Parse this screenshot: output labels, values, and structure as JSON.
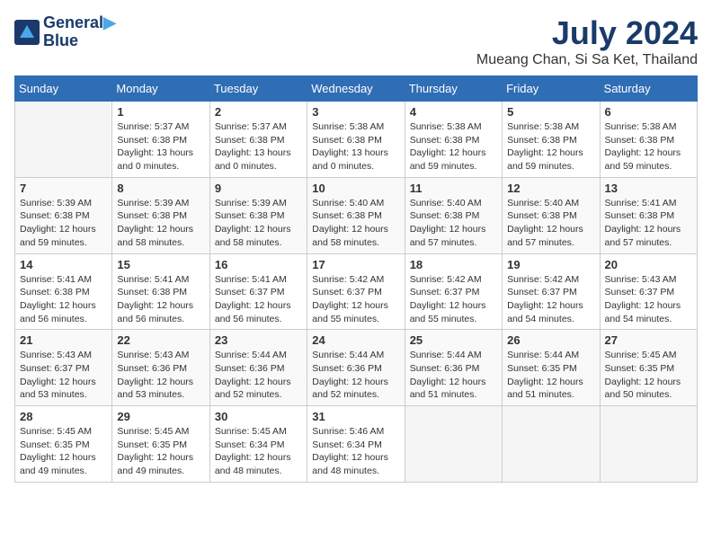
{
  "header": {
    "logo_line1": "General",
    "logo_line2": "Blue",
    "month": "July 2024",
    "location": "Mueang Chan, Si Sa Ket, Thailand"
  },
  "days_of_week": [
    "Sunday",
    "Monday",
    "Tuesday",
    "Wednesday",
    "Thursday",
    "Friday",
    "Saturday"
  ],
  "weeks": [
    [
      {
        "day": "",
        "info": ""
      },
      {
        "day": "1",
        "info": "Sunrise: 5:37 AM\nSunset: 6:38 PM\nDaylight: 13 hours\nand 0 minutes."
      },
      {
        "day": "2",
        "info": "Sunrise: 5:37 AM\nSunset: 6:38 PM\nDaylight: 13 hours\nand 0 minutes."
      },
      {
        "day": "3",
        "info": "Sunrise: 5:38 AM\nSunset: 6:38 PM\nDaylight: 13 hours\nand 0 minutes."
      },
      {
        "day": "4",
        "info": "Sunrise: 5:38 AM\nSunset: 6:38 PM\nDaylight: 12 hours\nand 59 minutes."
      },
      {
        "day": "5",
        "info": "Sunrise: 5:38 AM\nSunset: 6:38 PM\nDaylight: 12 hours\nand 59 minutes."
      },
      {
        "day": "6",
        "info": "Sunrise: 5:38 AM\nSunset: 6:38 PM\nDaylight: 12 hours\nand 59 minutes."
      }
    ],
    [
      {
        "day": "7",
        "info": "Sunrise: 5:39 AM\nSunset: 6:38 PM\nDaylight: 12 hours\nand 59 minutes."
      },
      {
        "day": "8",
        "info": "Sunrise: 5:39 AM\nSunset: 6:38 PM\nDaylight: 12 hours\nand 58 minutes."
      },
      {
        "day": "9",
        "info": "Sunrise: 5:39 AM\nSunset: 6:38 PM\nDaylight: 12 hours\nand 58 minutes."
      },
      {
        "day": "10",
        "info": "Sunrise: 5:40 AM\nSunset: 6:38 PM\nDaylight: 12 hours\nand 58 minutes."
      },
      {
        "day": "11",
        "info": "Sunrise: 5:40 AM\nSunset: 6:38 PM\nDaylight: 12 hours\nand 57 minutes."
      },
      {
        "day": "12",
        "info": "Sunrise: 5:40 AM\nSunset: 6:38 PM\nDaylight: 12 hours\nand 57 minutes."
      },
      {
        "day": "13",
        "info": "Sunrise: 5:41 AM\nSunset: 6:38 PM\nDaylight: 12 hours\nand 57 minutes."
      }
    ],
    [
      {
        "day": "14",
        "info": "Sunrise: 5:41 AM\nSunset: 6:38 PM\nDaylight: 12 hours\nand 56 minutes."
      },
      {
        "day": "15",
        "info": "Sunrise: 5:41 AM\nSunset: 6:38 PM\nDaylight: 12 hours\nand 56 minutes."
      },
      {
        "day": "16",
        "info": "Sunrise: 5:41 AM\nSunset: 6:37 PM\nDaylight: 12 hours\nand 56 minutes."
      },
      {
        "day": "17",
        "info": "Sunrise: 5:42 AM\nSunset: 6:37 PM\nDaylight: 12 hours\nand 55 minutes."
      },
      {
        "day": "18",
        "info": "Sunrise: 5:42 AM\nSunset: 6:37 PM\nDaylight: 12 hours\nand 55 minutes."
      },
      {
        "day": "19",
        "info": "Sunrise: 5:42 AM\nSunset: 6:37 PM\nDaylight: 12 hours\nand 54 minutes."
      },
      {
        "day": "20",
        "info": "Sunrise: 5:43 AM\nSunset: 6:37 PM\nDaylight: 12 hours\nand 54 minutes."
      }
    ],
    [
      {
        "day": "21",
        "info": "Sunrise: 5:43 AM\nSunset: 6:37 PM\nDaylight: 12 hours\nand 53 minutes."
      },
      {
        "day": "22",
        "info": "Sunrise: 5:43 AM\nSunset: 6:36 PM\nDaylight: 12 hours\nand 53 minutes."
      },
      {
        "day": "23",
        "info": "Sunrise: 5:44 AM\nSunset: 6:36 PM\nDaylight: 12 hours\nand 52 minutes."
      },
      {
        "day": "24",
        "info": "Sunrise: 5:44 AM\nSunset: 6:36 PM\nDaylight: 12 hours\nand 52 minutes."
      },
      {
        "day": "25",
        "info": "Sunrise: 5:44 AM\nSunset: 6:36 PM\nDaylight: 12 hours\nand 51 minutes."
      },
      {
        "day": "26",
        "info": "Sunrise: 5:44 AM\nSunset: 6:35 PM\nDaylight: 12 hours\nand 51 minutes."
      },
      {
        "day": "27",
        "info": "Sunrise: 5:45 AM\nSunset: 6:35 PM\nDaylight: 12 hours\nand 50 minutes."
      }
    ],
    [
      {
        "day": "28",
        "info": "Sunrise: 5:45 AM\nSunset: 6:35 PM\nDaylight: 12 hours\nand 49 minutes."
      },
      {
        "day": "29",
        "info": "Sunrise: 5:45 AM\nSunset: 6:35 PM\nDaylight: 12 hours\nand 49 minutes."
      },
      {
        "day": "30",
        "info": "Sunrise: 5:45 AM\nSunset: 6:34 PM\nDaylight: 12 hours\nand 48 minutes."
      },
      {
        "day": "31",
        "info": "Sunrise: 5:46 AM\nSunset: 6:34 PM\nDaylight: 12 hours\nand 48 minutes."
      },
      {
        "day": "",
        "info": ""
      },
      {
        "day": "",
        "info": ""
      },
      {
        "day": "",
        "info": ""
      }
    ]
  ]
}
